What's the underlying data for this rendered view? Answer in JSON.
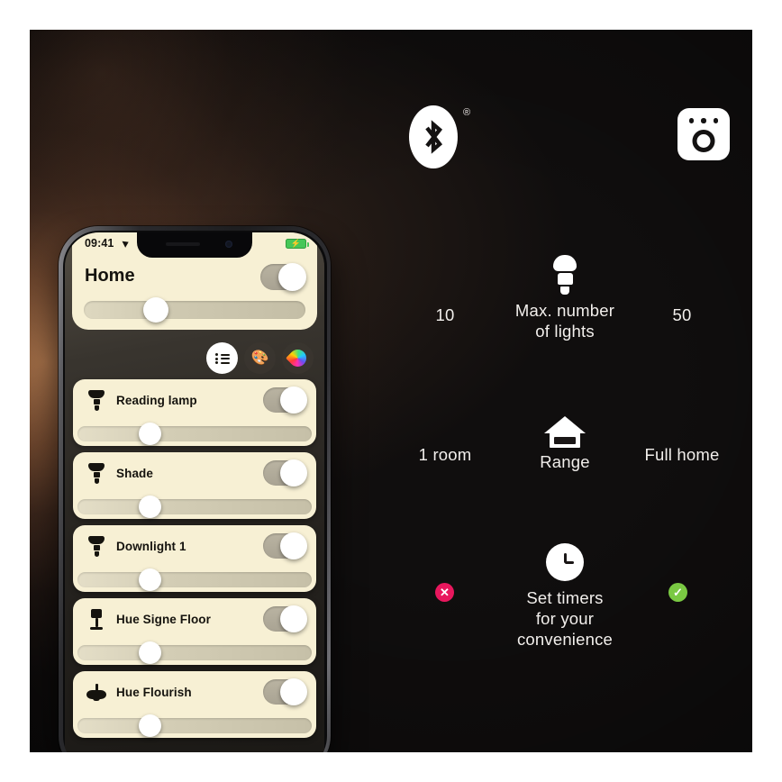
{
  "colors": {
    "card_cream": "#f7f0d4",
    "badge_error": "#e8175d",
    "badge_ok": "#7ac943",
    "battery_green": "#46c758",
    "bg_glow": "#e89e66"
  },
  "icons": {
    "bluetooth": "bluetooth-icon",
    "bluetooth_registered": "®",
    "bridge": "hue-bridge-icon",
    "bulb": "light-bulb-icon",
    "house": "house-icon",
    "clock": "clock-icon",
    "error_glyph": "✕",
    "ok_glyph": "✓",
    "battery_bolt": "⚡",
    "palette": "🎨"
  },
  "comparison": {
    "rows": [
      {
        "left": "10",
        "right": "50",
        "caption": "Max. number\nof lights",
        "caption_line1": "Max. number",
        "caption_line2": "of lights",
        "icon": "light-bulb-icon"
      },
      {
        "left": "1 room",
        "right": "Full home",
        "caption_line1": "Range",
        "caption_line2": "",
        "icon": "house-icon"
      },
      {
        "left": "",
        "right": "",
        "caption_line1": "Set timers",
        "caption_line2": "for your",
        "caption_line3": "convenience",
        "icon": "clock-icon"
      }
    ]
  },
  "phone": {
    "status_bar": {
      "time": "09:41",
      "location_icon": "location-arrow-icon",
      "battery_icon": "battery-charging-icon"
    },
    "header": {
      "title": "Home",
      "toggle_on": true,
      "brightness_percent": 27
    },
    "segmented_control": {
      "items": [
        {
          "name": "list-view",
          "icon": "list-icon",
          "active": true
        },
        {
          "name": "scenes-view",
          "icon": "palette-icon",
          "active": false
        },
        {
          "name": "color-view",
          "icon": "color-drop-icon",
          "active": false
        }
      ]
    },
    "lights": [
      {
        "name": "Reading lamp",
        "icon": "spot-bulb-icon",
        "on": true,
        "brightness_percent": 26
      },
      {
        "name": "Shade",
        "icon": "spot-bulb-icon",
        "on": true,
        "brightness_percent": 26
      },
      {
        "name": "Downlight 1",
        "icon": "spot-bulb-icon",
        "on": true,
        "brightness_percent": 26
      },
      {
        "name": "Hue Signe Floor",
        "icon": "floor-lamp-icon",
        "on": true,
        "brightness_percent": 26
      },
      {
        "name": "Hue Flourish",
        "icon": "pendant-lamp-icon",
        "on": true,
        "brightness_percent": 26
      }
    ]
  }
}
